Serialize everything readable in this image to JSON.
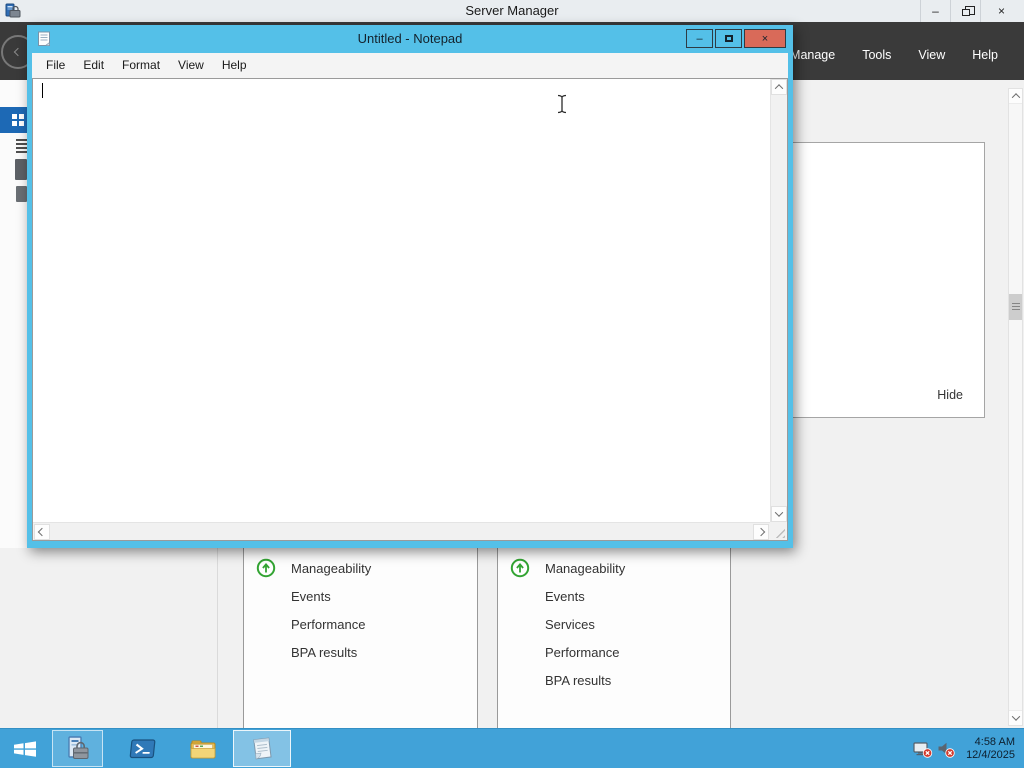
{
  "server_manager": {
    "window_title": "Server Manager",
    "caption": {
      "minimize": "–",
      "close": "×"
    },
    "command_bar": {
      "items": [
        "Manage",
        "Tools",
        "View",
        "Help"
      ]
    },
    "welcome_panel": {
      "hide_label": "Hide"
    },
    "dashboard_tiles": [
      {
        "rows": [
          "Manageability",
          "Events",
          "Performance",
          "BPA results"
        ]
      },
      {
        "rows": [
          "Manageability",
          "Events",
          "Services",
          "Performance",
          "BPA results"
        ]
      }
    ]
  },
  "notepad": {
    "window_title": "Untitled - Notepad",
    "caption": {
      "minimize": "–",
      "close": "×"
    },
    "menu_bar": {
      "items": [
        "File",
        "Edit",
        "Format",
        "View",
        "Help"
      ]
    },
    "text_content": ""
  },
  "taskbar": {
    "clock": {
      "time": "4:58 AM",
      "date": "12/4/2025"
    }
  },
  "colors": {
    "accent_blue": "#54c0e8",
    "taskbar_blue": "#41a2d8",
    "close_red": "#d96a59",
    "nav_selected_blue": "#1d69b5",
    "status_green": "#33a433",
    "command_bar_dark": "#3a3a3a"
  }
}
